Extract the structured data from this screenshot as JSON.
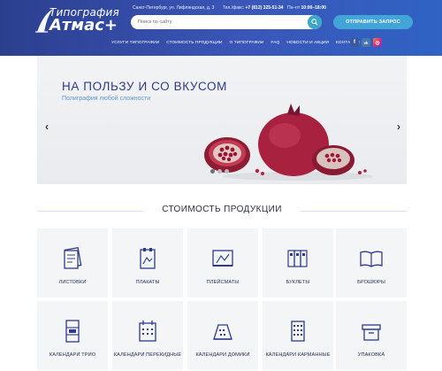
{
  "header": {
    "logo_top": "Типография",
    "logo_main": "Атмас+",
    "address": "Санкт-Петербург, ул. Лифляндская, д. 3",
    "phone_label": "Тел./факс:",
    "phone": "+7 (812) 325-51-34",
    "hours_label": "Пн–пт",
    "hours": "10:00–18:00",
    "search_placeholder": "Поиск по сайту",
    "request_button": "ОТПРАВИТЬ ЗАПРОС",
    "accent_color": "#42a5d8",
    "brand_color": "#2c3f8f"
  },
  "nav": {
    "items": [
      {
        "label": "УСЛУГИ ТИПОГРАФИИ"
      },
      {
        "label": "СТОИМОСТЬ ПРОДУКЦИИ"
      },
      {
        "label": "О ТИПОГРАФИИ"
      },
      {
        "label": "FAQ"
      },
      {
        "label": "НОВОСТИ И АКЦИИ"
      },
      {
        "label": "КОНТАКТЫ"
      }
    ]
  },
  "social": {
    "fb": "f",
    "vk": "vk",
    "ig": "◎"
  },
  "slider": {
    "title": "НА ПОЛЬЗУ И СО ВКУСОМ",
    "subtitle": "Полиграфия любой сложности",
    "prev_arrow": "‹",
    "next_arrow": "›",
    "dots_total": 3,
    "active_dot": 1
  },
  "products": {
    "title": "СТОИМОСТЬ ПРОДУКЦИИ",
    "items": [
      {
        "label": "ЛИСТОВКИ",
        "icon": "leaflet-icon"
      },
      {
        "label": "ПЛАКАТЫ",
        "icon": "poster-icon"
      },
      {
        "label": "ПЛЕЙСМАТЫ",
        "icon": "placemat-icon"
      },
      {
        "label": "БУКЛЕТЫ",
        "icon": "booklet-icon"
      },
      {
        "label": "БРОШЮРЫ",
        "icon": "brochure-icon"
      },
      {
        "label": "КАЛЕНДАРИ ТРИО",
        "icon": "calendar-trio-icon"
      },
      {
        "label": "КАЛЕНДАРИ ПЕРЕКИДНЫЕ",
        "icon": "flip-calendar-icon"
      },
      {
        "label": "КАЛЕНДАРИ ДОМИКИ",
        "icon": "desk-calendar-icon"
      },
      {
        "label": "КАЛЕНДАРИ КАРМАННЫЕ",
        "icon": "pocket-calendar-icon"
      },
      {
        "label": "УПАКОВКА",
        "icon": "package-icon"
      }
    ]
  }
}
